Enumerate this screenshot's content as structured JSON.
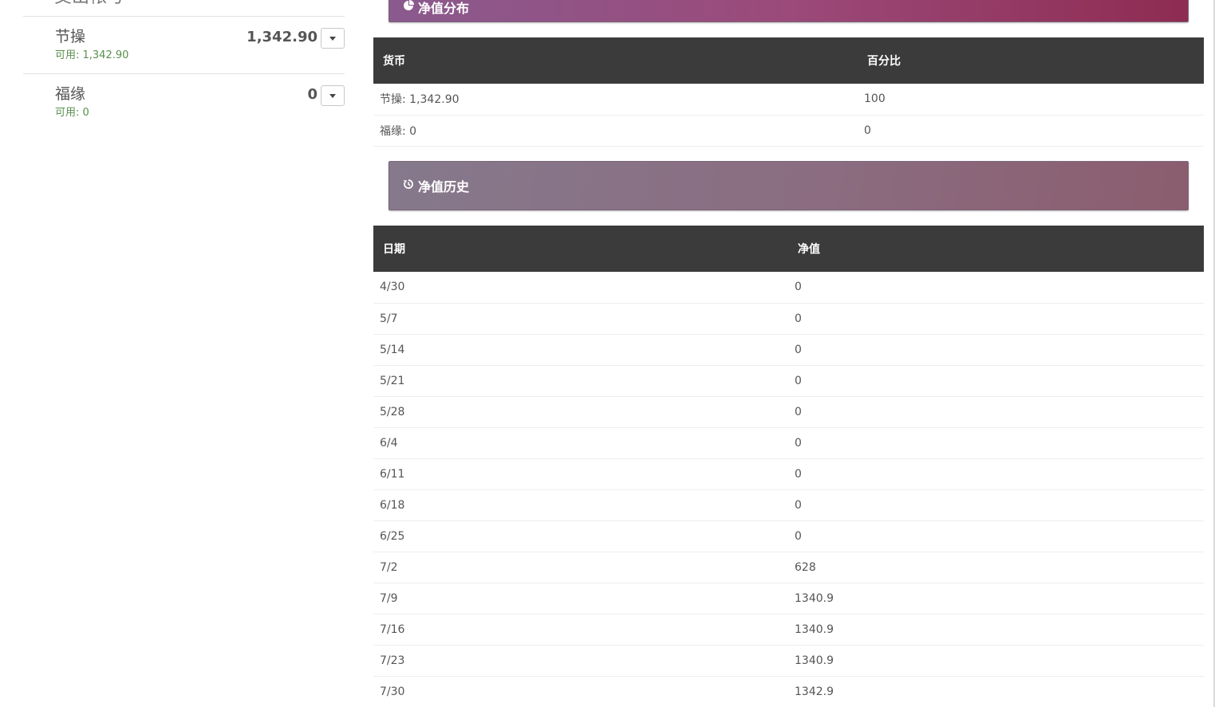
{
  "sidebar": {
    "title": "交出帐号",
    "accounts": [
      {
        "name": "节操",
        "balance": "1,342.90",
        "available": "可用: 1,342.90"
      },
      {
        "name": "福缘",
        "balance": "0",
        "available": "可用: 0"
      }
    ]
  },
  "main": {
    "distribution_panel": {
      "title": "净值分布",
      "icon": "pie-chart-icon"
    },
    "distribution_table": {
      "headers": [
        "货币",
        "百分比"
      ],
      "rows": [
        [
          "节操: 1,342.90",
          "100"
        ],
        [
          "福缘: 0",
          "0"
        ]
      ]
    },
    "history_panel": {
      "title": "净值历史",
      "icon": "history-icon"
    },
    "history_table": {
      "headers": [
        "日期",
        "净值"
      ],
      "rows": [
        [
          "4/30",
          "0"
        ],
        [
          "5/7",
          "0"
        ],
        [
          "5/14",
          "0"
        ],
        [
          "5/21",
          "0"
        ],
        [
          "5/28",
          "0"
        ],
        [
          "6/4",
          "0"
        ],
        [
          "6/11",
          "0"
        ],
        [
          "6/18",
          "0"
        ],
        [
          "6/25",
          "0"
        ],
        [
          "7/2",
          "628"
        ],
        [
          "7/9",
          "1340.9"
        ],
        [
          "7/16",
          "1340.9"
        ],
        [
          "7/23",
          "1340.9"
        ],
        [
          "7/30",
          "1342.9"
        ]
      ]
    }
  }
}
